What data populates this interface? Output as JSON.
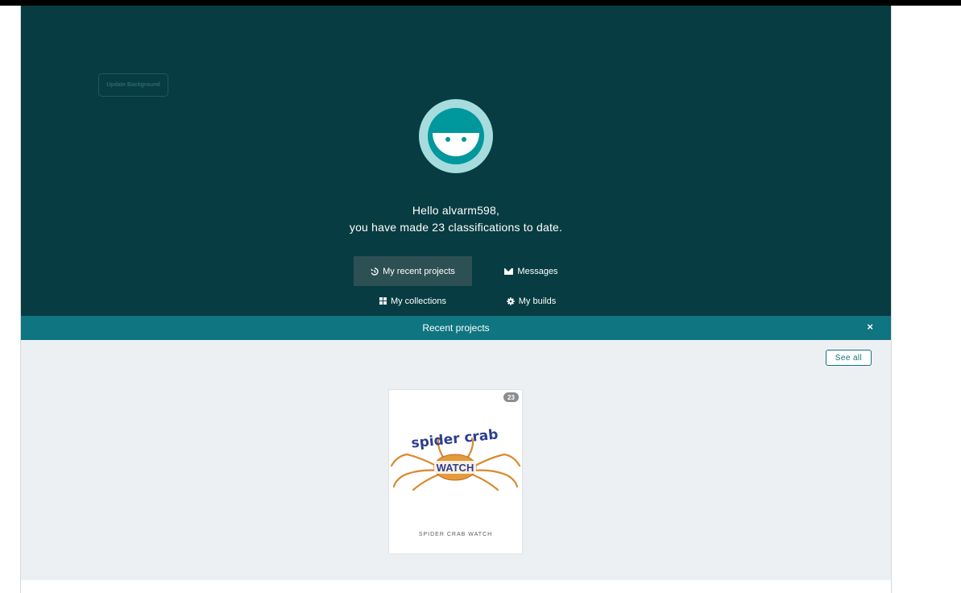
{
  "hero": {
    "update_background_label": "Update Background",
    "greeting_line1": "Hello alvarm598,",
    "greeting_line2": "you have made 23 classifications to date."
  },
  "nav": {
    "recent_projects": "My recent projects",
    "messages": "Messages",
    "collections": "My collections",
    "builds": "My builds"
  },
  "recent": {
    "title": "Recent projects",
    "close_icon": "×",
    "see_all": "See all",
    "projects": [
      {
        "name": "SPIDER CRAB WATCH",
        "count": "23",
        "logo_top": "spider crab",
        "logo_bottom": "WATCH"
      }
    ]
  },
  "colors": {
    "hero_bg": "#073c42",
    "accent": "#0f7580",
    "avatar_ring": "#a6dcdd",
    "avatar_face": "#00979d"
  },
  "icons": [
    "history-icon",
    "envelope-icon",
    "grid-icon",
    "gear-icon",
    "close-icon",
    "zooniverse-avatar-icon"
  ]
}
